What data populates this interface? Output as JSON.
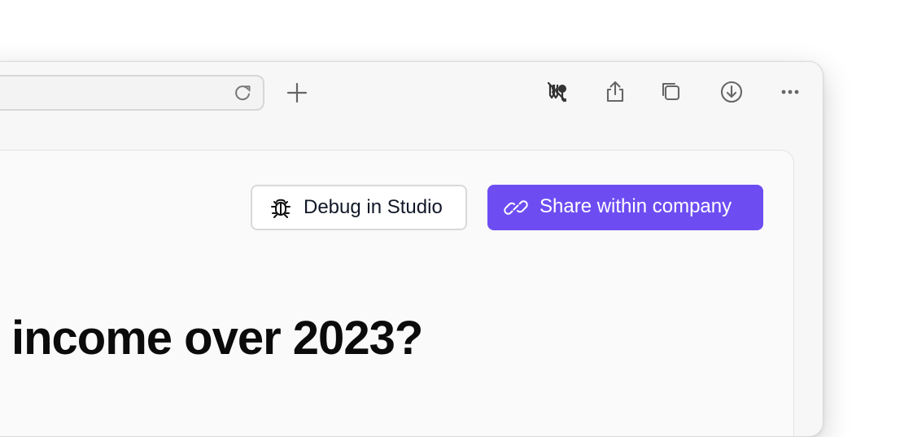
{
  "toolbar": {
    "address_bar_value": "",
    "icons": [
      "reload-icon",
      "new-tab-icon",
      "password-key-icon",
      "share-icon",
      "tabs-copy-icon",
      "download-icon",
      "more-icon"
    ]
  },
  "content": {
    "debug_button_label": "Debug in Studio",
    "share_button_label": "Share within company",
    "title": "income over 2023?"
  },
  "colors": {
    "accent": "#6d4df2",
    "text_primary": "#111827",
    "surface": "#fafafa"
  }
}
